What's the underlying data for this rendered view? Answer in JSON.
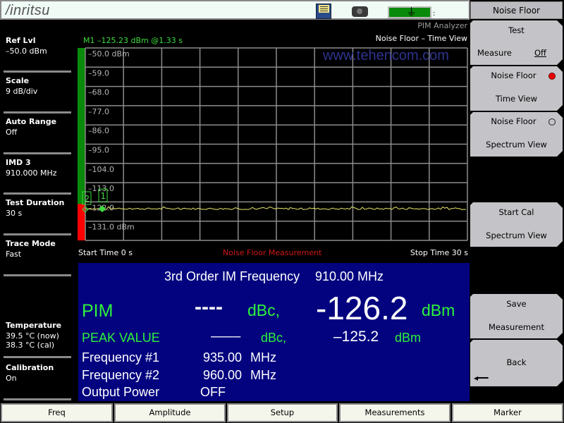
{
  "titlebar": {
    "brand": "/inritsu",
    "icons": [
      "save-icon",
      "camera-icon",
      "battery-plug-icon"
    ],
    "battery_fill": 1.0,
    "battery_color": "#0a8a0a"
  },
  "header": {
    "mode": "PIM Analyzer",
    "view": "Noise Floor – Time View",
    "marker_readout": "M1 –125.23 dBm @1.33 s"
  },
  "left_panel": [
    {
      "label": "Ref Lvl",
      "value": "–50.0 dBm"
    },
    {
      "label": "Scale",
      "value": "9 dB/div"
    },
    {
      "label": "Auto Range",
      "value": "Off"
    },
    {
      "label": "IMD 3",
      "value": "910.000 MHz"
    },
    {
      "label": "Test Duration",
      "value": "30 s"
    },
    {
      "label": "Trace Mode",
      "value": "Fast"
    },
    {
      "label": "Temperature",
      "value": "39.5 °C  (now)",
      "value2": "38.3 °C  (cal)"
    },
    {
      "label": "Calibration",
      "value": "On"
    }
  ],
  "plot": {
    "watermark": "www.tehencom.com",
    "ref_level_dbm": -50.0,
    "scale_db_per_div": 9,
    "y_labels": [
      "–50.0 dBm",
      "–59.0",
      "–68.0",
      "–77.0",
      "–86.0",
      "–95.0",
      "–104.0",
      "–113.0",
      "–122.0",
      "–131.0 dBm"
    ],
    "y_range": [
      -140,
      -50
    ],
    "x_range_s": [
      0,
      30
    ],
    "limit_bar": {
      "pass_color": "#0a8a0a",
      "fail_color": "#ff0000",
      "threshold_dbm": -122.0
    },
    "trace_color": "#e8e86a",
    "trace_level_dbm": -125.2,
    "markers": [
      {
        "id": "1",
        "time_s": 1.33,
        "value_dbm": -125.23
      },
      {
        "id": "2",
        "time_s": 0.0,
        "value_dbm": -125.5
      }
    ],
    "start_time": "Start Time 0 s",
    "measurement_name": "Noise Floor Measurement",
    "stop_time": "Stop Time  30 s"
  },
  "results": {
    "im_freq_label": "3rd Order IM Frequency",
    "im_freq_value": "910.00 MHz",
    "pim_label": "PIM",
    "pim_dbc": "----",
    "dbc_unit": "dBc,",
    "pim_dbm": "-126.2",
    "dbm_unit": "dBm",
    "peak_label": "PEAK VALUE",
    "peak_dbc": "––––",
    "peak_dbm": "–125.2",
    "f1_label": "Frequency #1",
    "f1_value": "935.00",
    "f2_label": "Frequency #2",
    "f2_value": "960.00",
    "mhz": "MHz",
    "power_label": "Output Power",
    "power_value": "OFF"
  },
  "softkeys": {
    "title": "Noise Floor",
    "keys": [
      {
        "l1": "Test",
        "l2": "Measure",
        "l2_value": "Off"
      },
      {
        "l1": "Noise Floor",
        "l2": "Time View",
        "selected": true
      },
      {
        "l1": "Noise Floor",
        "l2": "Spectrum View",
        "selected": false
      },
      {
        "l1": "Start Cal",
        "l2": "Spectrum View"
      },
      {
        "l1": "Save",
        "l2": "Measurement"
      },
      {
        "l1": "Back",
        "l2": ""
      }
    ]
  },
  "bottom_tabs": [
    "Freq",
    "Amplitude",
    "Setup",
    "Measurements",
    "Marker"
  ]
}
